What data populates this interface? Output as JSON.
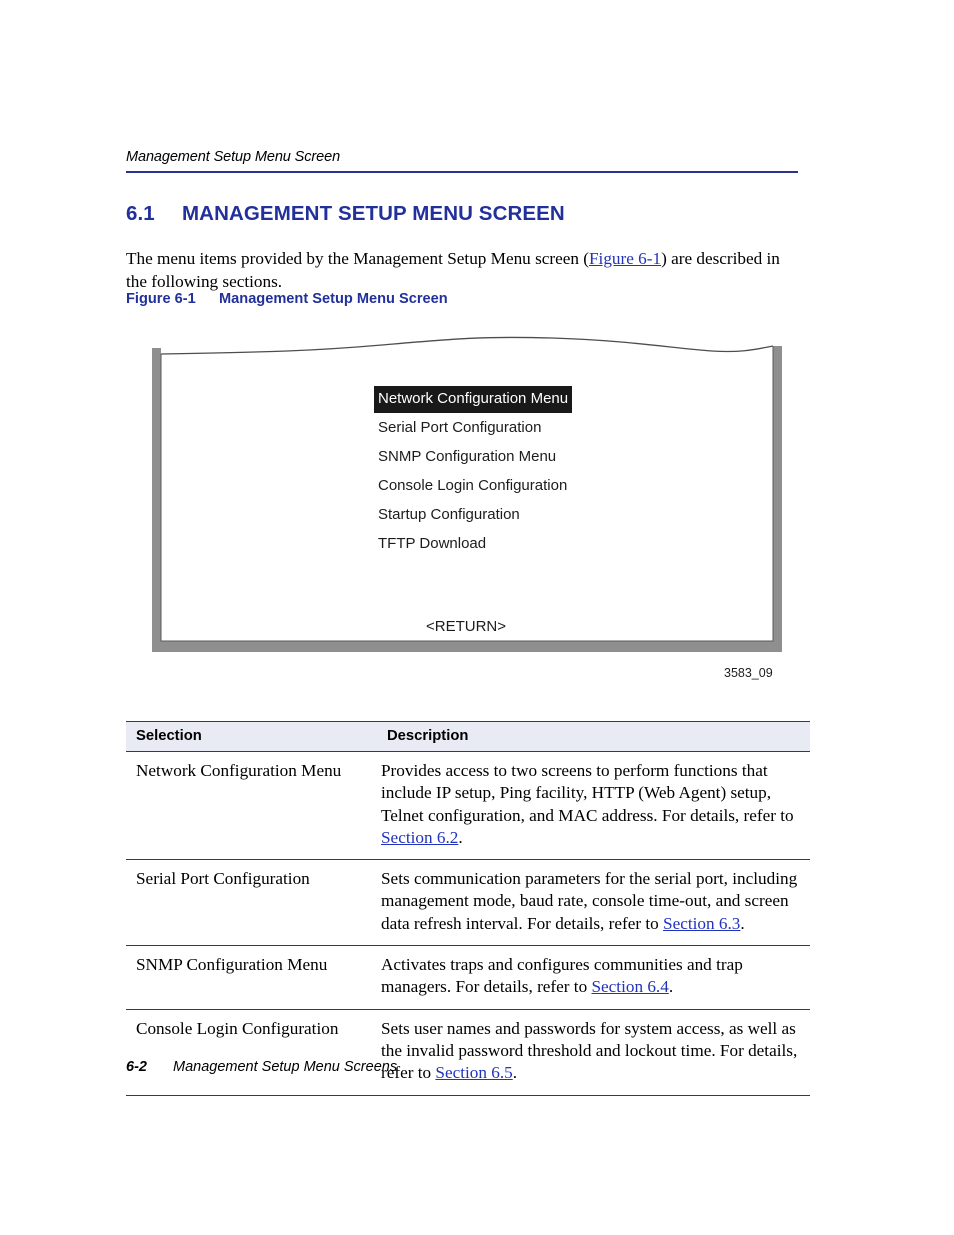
{
  "running_header": {
    "text": "Management Setup Menu Screen"
  },
  "section": {
    "number": "6.1",
    "title": "MANAGEMENT SETUP MENU SCREEN",
    "intro_part1": "The menu items provided by the Management Setup Menu screen (",
    "intro_link": "Figure 6-1",
    "intro_part2": ") are described in the following sections."
  },
  "figure": {
    "caption_number": "Figure 6-1",
    "caption_title": "Management Setup Menu Screen",
    "id_label": "3583_09",
    "screen": {
      "menu_items": [
        {
          "label": "Network Configuration Menu",
          "selected": true
        },
        {
          "label": "Serial Port Configuration",
          "selected": false
        },
        {
          "label": "SNMP Configuration Menu",
          "selected": false
        },
        {
          "label": "Console Login Configuration",
          "selected": false
        },
        {
          "label": "Startup Configuration",
          "selected": false
        },
        {
          "label": "TFTP Download",
          "selected": false
        }
      ],
      "return_label": "<RETURN>"
    }
  },
  "table": {
    "headers": {
      "selection": "Selection",
      "description": "Description"
    },
    "rows": [
      {
        "selection": "Network Configuration Menu",
        "desc_part1": "Provides access to two screens to perform functions that include IP setup, Ping facility, HTTP (Web Agent) setup, Telnet configuration, and MAC address. For details, refer to ",
        "desc_link": "Section 6.2",
        "desc_part2": "."
      },
      {
        "selection": "Serial Port Configuration",
        "desc_part1": "Sets communication parameters for the serial port, including management mode, baud rate, console time-out, and screen data refresh interval. For details, refer to ",
        "desc_link": "Section 6.3",
        "desc_part2": "."
      },
      {
        "selection": "SNMP Configuration Menu",
        "desc_part1": "Activates traps and configures communities and trap managers. For details, refer to ",
        "desc_link": "Section 6.4",
        "desc_part2": "."
      },
      {
        "selection": "Console Login Configuration",
        "desc_part1": "Sets user names and passwords for system access, as well as the invalid password threshold and lockout time. For details, refer to ",
        "desc_link": "Section 6.5",
        "desc_part2": "."
      }
    ]
  },
  "footer": {
    "page_number": "6-2",
    "text": "Management Setup Menu Screens"
  },
  "colors": {
    "heading_blue": "#22309c",
    "rule_blue": "#26348c",
    "link_blue": "#2233bb",
    "table_header_bg": "#e8eaf4",
    "frame_gray": "#8f8f8f",
    "selected_bg": "#191919"
  }
}
